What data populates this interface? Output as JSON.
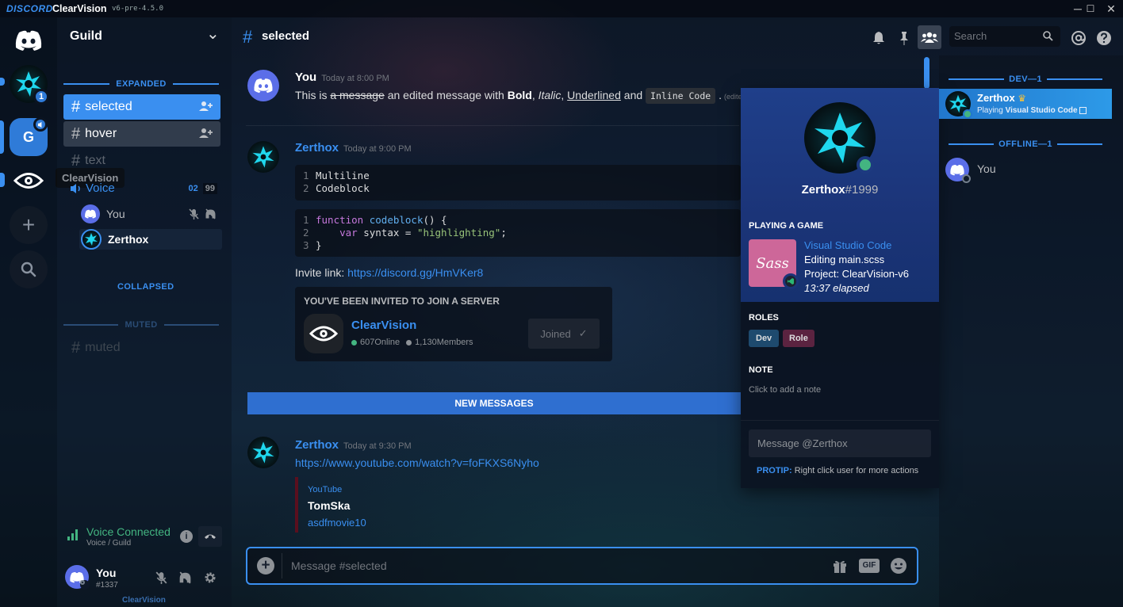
{
  "titlebar": {
    "brand": "DISCORD",
    "app": "ClearVision",
    "version": "v6-pre-4.5.0",
    "min": "─",
    "max": "☐",
    "close": "✕"
  },
  "guilds": {
    "badge_count": "1",
    "guild_letter": "G",
    "tooltip": "ClearVision",
    "add": "+",
    "search_glyph": "⌕"
  },
  "sidebar": {
    "guild_name": "Guild",
    "chevron": "⌄",
    "cat_expanded": "EXPANDED",
    "cat_collapsed": "COLLAPSED",
    "cat_muted": "MUTED",
    "hash": "#",
    "channels": [
      {
        "label": "selected"
      },
      {
        "label": "hover"
      },
      {
        "label": "text"
      },
      {
        "label": "muted"
      }
    ],
    "voice": {
      "label": "Voice",
      "count": "02",
      "limit": "99"
    },
    "voice_users": [
      {
        "name": "You"
      },
      {
        "name": "Zerthox"
      }
    ],
    "voice_connected": "Voice Connected",
    "voice_location": "Voice / Guild",
    "user": {
      "name": "You",
      "tag": "#1337"
    },
    "footer": "ClearVision"
  },
  "header": {
    "hash": "#",
    "channel": "selected",
    "search_placeholder": "Search"
  },
  "messages": [
    {
      "author": "You",
      "ts": "Today at 8:00 PM",
      "pre": "This is ",
      "strike": "a message",
      "mid": " an edited message with ",
      "bold": "Bold",
      "c1": ", ",
      "italic": "Italic",
      "c2": ", ",
      "underline": "Underlined",
      "and": " and ",
      "code": "Inline Code",
      "dot": " .",
      "edited": "(edited)"
    },
    {
      "author": "Zerthox",
      "ts": "Today at 9:00 PM",
      "code1": [
        {
          "n": "1",
          "t": "Multiline"
        },
        {
          "n": "2",
          "t": "Codeblock"
        }
      ],
      "code2": {
        "n1": "1",
        "kw1": "function",
        "fn": "codeblock",
        "paren": "() {",
        "n2": "2",
        "kw2": "var",
        "var": " syntax = ",
        "str": "\"highlighting\"",
        "semi": ";",
        "n3": "3",
        "close": "}"
      },
      "invite_label": "Invite link: ",
      "invite_url": "https://discord.gg/HmVKer8",
      "invite": {
        "heading": "YOU'VE BEEN INVITED TO JOIN A SERVER",
        "server": "ClearVision",
        "online": "607",
        "online_label": "Online",
        "members": "1,130",
        "members_label": "Members",
        "button": "Joined",
        "check": "✓"
      }
    },
    {
      "author": "Zerthox",
      "ts": "Today at 9:30 PM",
      "link": "https://www.youtube.com/watch?v=foFKXS6Nyho",
      "embed": {
        "provider": "YouTube",
        "author": "TomSka",
        "title": "asdfmovie10"
      }
    }
  ],
  "new_messages": "NEW MESSAGES",
  "composer": {
    "placeholder": "Message #selected",
    "plus": "+",
    "gif": "GIF"
  },
  "popout": {
    "username": "Zerthox",
    "discriminator": "#1999",
    "playing_label": "PLAYING A GAME",
    "game": "Visual Studio Code",
    "details": "Editing main.scss",
    "state": "Project: ClearVision-v6",
    "elapsed": "13:37 elapsed",
    "sass": "Sass",
    "roles_label": "ROLES",
    "roles": [
      {
        "name": "Dev"
      },
      {
        "name": "Role"
      }
    ],
    "note_label": "NOTE",
    "note_placeholder": "Click to add a note",
    "message_placeholder": "Message @Zerthox",
    "protip_label": "PROTIP:",
    "protip_text": "Right click user for more actions"
  },
  "members": {
    "cat_dev": "DEV—1",
    "cat_offline": "OFFLINE—1",
    "online": {
      "name": "Zerthox",
      "crown": "♛",
      "activity_pre": "Playing ",
      "activity": "Visual Studio Code"
    },
    "offline": {
      "name": "You"
    }
  },
  "colors": {
    "accent": "#3a8ff0",
    "online": "#43b581",
    "role_dev": "#1e4a6e",
    "role_role": "#5b2340"
  }
}
